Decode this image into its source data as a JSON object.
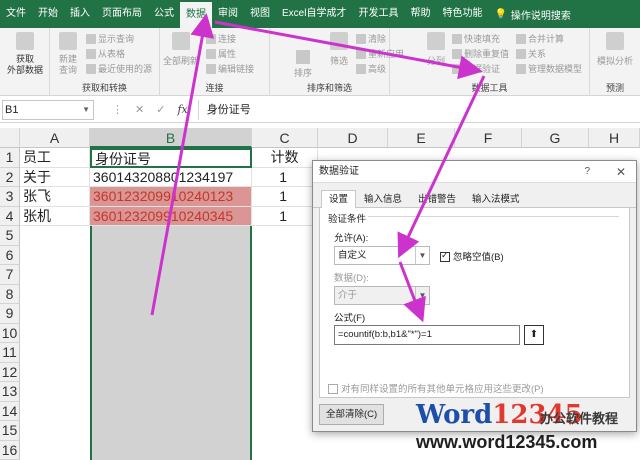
{
  "ribbon_tabs": [
    "文件",
    "开始",
    "插入",
    "页面布局",
    "公式",
    "数据",
    "审阅",
    "视图",
    "Excel自学成才",
    "开发工具",
    "帮助",
    "特色功能"
  ],
  "active_tab": "数据",
  "tell_me": "操作说明搜索",
  "ribbon": {
    "get_data": "获取\n外部数据",
    "new_query": "新建\n查询",
    "show_queries": "显示查询",
    "from_table": "从表格",
    "recent_sources": "最近使用的源",
    "group_get_transform": "获取和转换",
    "refresh_all": "全部刷新",
    "connections": "连接",
    "properties": "属性",
    "edit_links": "编辑链接",
    "group_connections": "连接",
    "sort": "排序",
    "filter": "筛选",
    "clear": "清除",
    "reapply": "重新应用",
    "advanced": "高级",
    "group_sort_filter": "排序和筛选",
    "text_to_columns": "分列",
    "flash_fill": "快速填充",
    "remove_duplicates": "删除重复值",
    "data_validation": "数据验证",
    "consolidate": "合并计算",
    "relationships": "关系",
    "manage_model": "管理数据模型",
    "group_data_tools": "数据工具",
    "what_if": "模拟分析",
    "forecast": "预测"
  },
  "formula_bar": {
    "name_box": "B1",
    "formula": "身份证号"
  },
  "columns": [
    "A",
    "B",
    "C",
    "D",
    "E",
    "F",
    "G",
    "H"
  ],
  "rows": [
    "1",
    "2",
    "3",
    "4",
    "5",
    "6",
    "7",
    "8",
    "9",
    "10",
    "11",
    "12",
    "13",
    "14",
    "15",
    "16"
  ],
  "cells": {
    "A": [
      "员工",
      "关于",
      "张飞",
      "张机"
    ],
    "B": [
      "身份证号",
      "360143208801234197",
      "360123209910240123",
      "360123209910240345"
    ],
    "C": [
      "计数",
      "1",
      "1",
      "1"
    ]
  },
  "dialog": {
    "title": "数据验证",
    "help": "?",
    "close": "✕",
    "tabs": [
      "设置",
      "输入信息",
      "出错警告",
      "输入法模式"
    ],
    "section": "验证条件",
    "allow_label": "允许(A):",
    "allow_value": "自定义",
    "ignore_blank": "忽略空值(B)",
    "data_label": "数据(D):",
    "data_value": "介于",
    "formula_label": "公式(F)",
    "formula_value": "=countif(b:b,b1&\"*\")=1",
    "apply_all": "对有同样设置的所有其他单元格应用这些更改(P)",
    "clear_all": "全部清除(C)"
  },
  "watermark": {
    "word": "Word",
    "digits": "12345",
    "tag": "办公软件教程",
    "url": "www.word12345.com"
  },
  "colors": {
    "excel_green": "#217346",
    "highlight": "#da9594",
    "red_text": "#c0392b",
    "arrow": "#cc33cc"
  }
}
